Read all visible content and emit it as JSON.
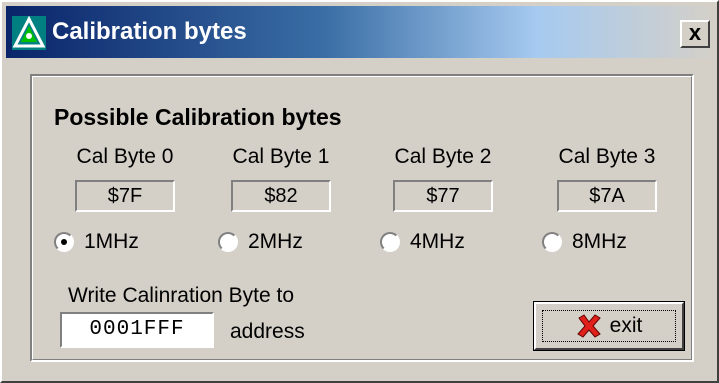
{
  "window": {
    "title": "Calibration bytes",
    "close_label": "x",
    "app_icon": "triangle-logo-icon"
  },
  "group": {
    "title": "Possible Calibration bytes"
  },
  "cal_bytes": [
    {
      "label": "Cal Byte 0",
      "value": "$7F",
      "radio_label": "1MHz",
      "selected": true
    },
    {
      "label": "Cal Byte 1",
      "value": "$82",
      "radio_label": "2MHz",
      "selected": false
    },
    {
      "label": "Cal Byte 2",
      "value": "$77",
      "radio_label": "4MHz",
      "selected": false
    },
    {
      "label": "Cal Byte 3",
      "value": "$7A",
      "radio_label": "8MHz",
      "selected": false
    }
  ],
  "write": {
    "label": "Write Calinration Byte to",
    "address_value": "0001FFF",
    "address_label": "address"
  },
  "exit_button": {
    "label": "exit",
    "icon": "red-x-icon"
  },
  "colors": {
    "title_bar_start": "#0a246a",
    "title_bar_end": "#a6caf0",
    "face": "#d4d0c8",
    "exit_icon": "#e0201a"
  }
}
